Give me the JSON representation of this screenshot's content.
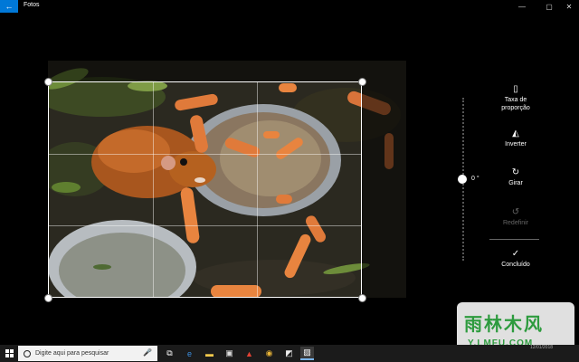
{
  "app": {
    "title": "Fotos",
    "back_icon": "back-arrow-icon"
  },
  "window_controls": [
    {
      "name": "minimize-icon",
      "glyph": "—"
    },
    {
      "name": "maximize-icon",
      "glyph": "▢"
    },
    {
      "name": "close-icon",
      "glyph": "✕"
    }
  ],
  "rotation": {
    "value_label": "0 °"
  },
  "tools": {
    "aspect_ratio": {
      "label_line1": "Taxa de",
      "label_line2": "proporção",
      "icon": "aspect-ratio-icon"
    },
    "flip": {
      "label": "Inverter",
      "icon": "flip-icon"
    },
    "rotate": {
      "label": "Girar",
      "icon": "rotate-icon"
    },
    "reset": {
      "label": "Redefinir",
      "icon": "reset-icon",
      "enabled": false
    },
    "done": {
      "label": "Concluído",
      "icon": "checkmark-icon"
    }
  },
  "taskbar": {
    "search_placeholder": "Digite aqui para pesquisar",
    "apps": [
      "task-view-icon",
      "edge-icon",
      "file-explorer-icon",
      "store-icon",
      "acrobat-icon",
      "chrome-icon",
      "sticky-notes-icon",
      "photos-icon"
    ],
    "clock": "12/01/2018"
  },
  "watermark": {
    "brand": "雨林木风",
    "url": "Y.LMFU.COM"
  },
  "colors": {
    "accent": "#0078d7",
    "taskbar": "#1b1b1b",
    "watermark_green": "#2d9b3e"
  }
}
